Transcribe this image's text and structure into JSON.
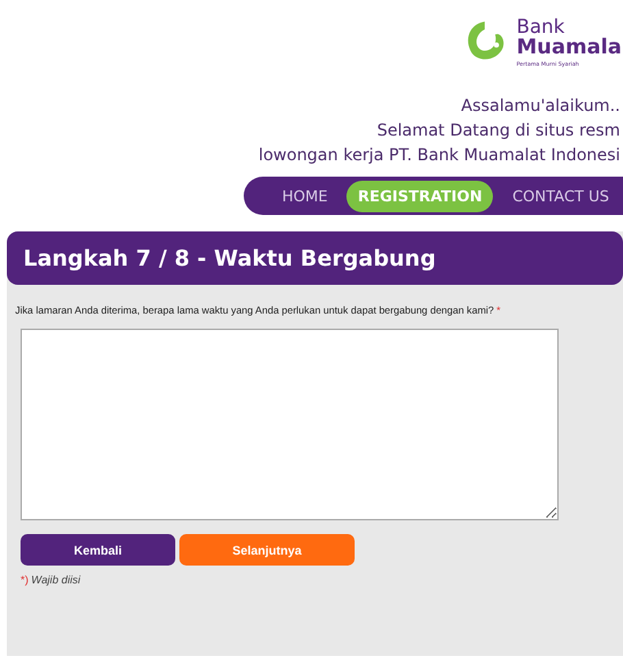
{
  "logo": {
    "line_1": "Bank",
    "line_2": "Muamala",
    "tagline": "Pertama Murni Syariah"
  },
  "greeting": [
    "Assalamu'alaikum..",
    "Selamat Datang di situs resm",
    "lowongan kerja PT. Bank Muamalat Indonesi"
  ],
  "nav": [
    {
      "label": "HOME",
      "selected": false
    },
    {
      "label": "REGISTRATION",
      "selected": true
    },
    {
      "label": "CONTACT US",
      "selected": false
    }
  ],
  "step_title": "Langkah 7 / 8 - Waktu Bergabung",
  "question": {
    "label": "Jika lamaran Anda diterima, berapa lama waktu yang Anda perlukan untuk dapat bergabung dengan kami?",
    "required_mark": "*"
  },
  "buttons": [
    {
      "label": "Kembali",
      "kind": "back"
    },
    {
      "label": "Selanjutnya",
      "kind": "next"
    }
  ],
  "footnote": {
    "mark": "*)",
    "text": "Wajib diisi"
  }
}
